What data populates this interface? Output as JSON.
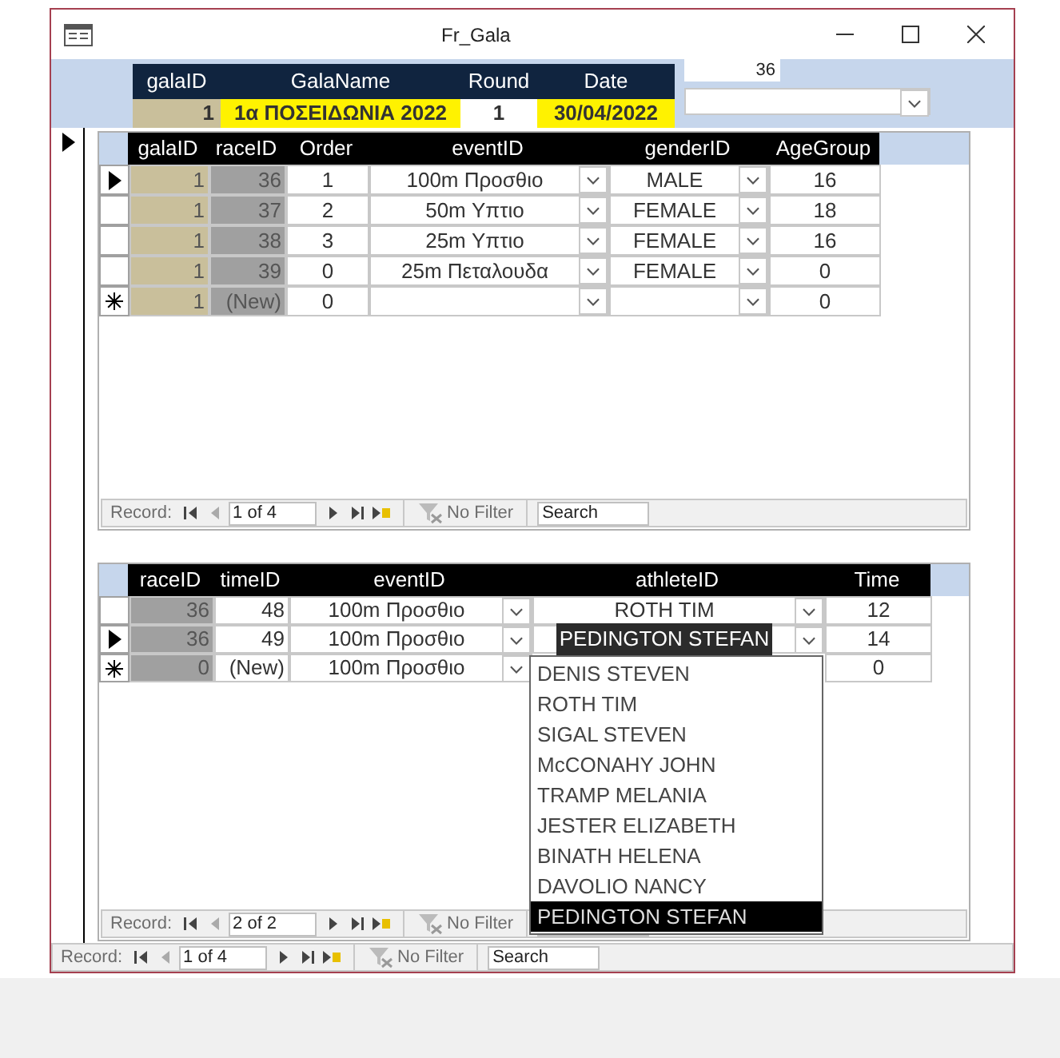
{
  "window": {
    "title": "Fr_Gala"
  },
  "gala": {
    "columns": [
      "galaID",
      "GalaName",
      "Round",
      "Date"
    ],
    "values": [
      "1",
      "1α ΠΟΣΕΙΔΩΝΙΑ 2022",
      "1",
      "30/04/2022"
    ]
  },
  "race_box": {
    "value": "36"
  },
  "races": {
    "columns": [
      "galaID",
      "raceID",
      "Order",
      "eventID",
      "genderID",
      "AgeGroup"
    ],
    "rows": [
      {
        "kind": "current",
        "gala_id": "1",
        "race_id": "36",
        "order": "1",
        "event": "100m  Προσθιο",
        "gender": "MALE",
        "age_group": "16"
      },
      {
        "kind": "blank",
        "gala_id": "1",
        "race_id": "37",
        "order": "2",
        "event": "50m  Υπτιο",
        "gender": "FEMALE",
        "age_group": "18"
      },
      {
        "kind": "blank",
        "gala_id": "1",
        "race_id": "38",
        "order": "3",
        "event": "25m  Υπτιο",
        "gender": "FEMALE",
        "age_group": "16"
      },
      {
        "kind": "blank",
        "gala_id": "1",
        "race_id": "39",
        "order": "0",
        "event": "25m  Πεταλουδα",
        "gender": "FEMALE",
        "age_group": "0"
      },
      {
        "kind": "new",
        "gala_id": "1",
        "race_id": "(New)",
        "order": "0",
        "age_group": "0"
      }
    ]
  },
  "races_nav": {
    "label": "Record:",
    "position": "1 of 4",
    "filter": "No Filter",
    "search": "Search"
  },
  "times": {
    "columns": [
      "raceID",
      "timeID",
      "eventID",
      "athleteID",
      "Time"
    ],
    "rows": [
      {
        "kind": "blank",
        "race_id": "36",
        "time_id": "48",
        "event": "100m  Προσθιο",
        "athlete": "ROTH TIM",
        "athlete_selected": false,
        "time": "12"
      },
      {
        "kind": "current",
        "race_id": "36",
        "time_id": "49",
        "event": "100m  Προσθιο",
        "athlete": "PEDINGTON STEFAN",
        "athlete_selected": true,
        "time": "14"
      },
      {
        "kind": "new",
        "race_id": "0",
        "time_id": "(New)",
        "event": "100m  Προσθιο",
        "time": "0"
      }
    ]
  },
  "times_nav": {
    "label": "Record:",
    "position": "2 of 2",
    "filter": "No Filter"
  },
  "athlete_dropdown": {
    "options": [
      {
        "label": "DENIS STEVEN",
        "selected": false
      },
      {
        "label": "ROTH TIM",
        "selected": false
      },
      {
        "label": "SIGAL STEVEN",
        "selected": false
      },
      {
        "label": "McCONAHY JOHN",
        "selected": false
      },
      {
        "label": "TRAMP MELANIA",
        "selected": false
      },
      {
        "label": "JESTER ELIZABETH",
        "selected": false
      },
      {
        "label": "BINATH HELENA",
        "selected": false
      },
      {
        "label": "DAVOLIO NANCY",
        "selected": false
      },
      {
        "label": "PEDINGTON STEFAN",
        "selected": true
      }
    ]
  },
  "main_nav": {
    "label": "Record:",
    "position": "1 of 4",
    "filter": "No Filter",
    "search": "Search"
  }
}
